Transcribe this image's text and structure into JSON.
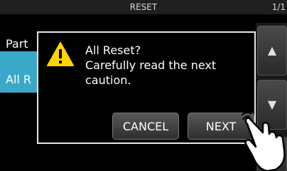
{
  "titlebar": {
    "title": "RESET",
    "page": "1/1"
  },
  "list": {
    "items": [
      {
        "label": "Part"
      },
      {
        "label": "All R"
      }
    ]
  },
  "sidebar": {
    "up_icon": "triangle-up-icon",
    "down_icon": "triangle-down-icon"
  },
  "dialog": {
    "icon": "warning-triangle-icon",
    "line1": "All Reset?",
    "line2": "Carefully read the next",
    "line3": "caution.",
    "cancel_label": "CANCEL",
    "next_label": "NEXT"
  },
  "overlay": {
    "icon": "pointing-hand-icon"
  },
  "colors": {
    "accent": "#3aa9c9",
    "warning": "#ffd400"
  }
}
